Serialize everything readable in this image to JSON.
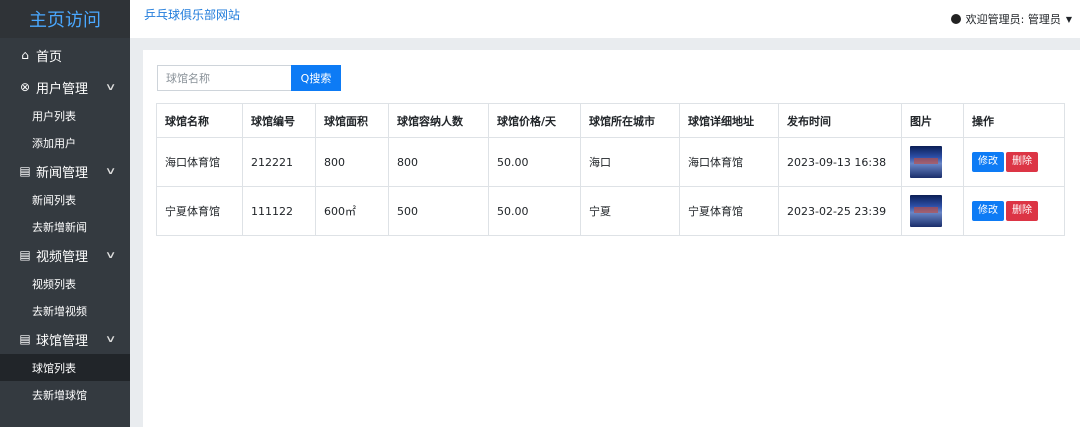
{
  "sidebar": {
    "brand": "主页访问",
    "home": {
      "icon": "home-icon",
      "label": "首页"
    },
    "groups": [
      {
        "icon": "user-circle-icon",
        "label": "用户管理",
        "items": [
          "用户列表",
          "添加用户"
        ]
      },
      {
        "icon": "document-icon",
        "label": "新闻管理",
        "items": [
          "新闻列表",
          "去新增新闻"
        ]
      },
      {
        "icon": "document-icon",
        "label": "视频管理",
        "items": [
          "视频列表",
          "去新增视频"
        ]
      },
      {
        "icon": "document-icon",
        "label": "球馆管理",
        "items": [
          "球馆列表",
          "去新增球馆"
        ]
      }
    ],
    "active_item": "球馆列表"
  },
  "header": {
    "site_title": "乒乓球俱乐部网站",
    "user_label": "欢迎管理员: 管理员"
  },
  "search": {
    "placeholder": "球馆名称",
    "value": "",
    "button_label": "Q搜索"
  },
  "table": {
    "columns": [
      "球馆名称",
      "球馆编号",
      "球馆面积",
      "球馆容纳人数",
      "球馆价格/天",
      "球馆所在城市",
      "球馆详细地址",
      "发布时间",
      "图片",
      "操作"
    ],
    "rows": [
      {
        "name": "海口体育馆",
        "code": "212221",
        "area": "800",
        "capacity": "800",
        "price": "50.00",
        "city": "海口",
        "address": "海口体育馆",
        "time": "2023-09-13 16:38"
      },
      {
        "name": "宁夏体育馆",
        "code": "111122",
        "area": "600㎡",
        "capacity": "500",
        "price": "50.00",
        "city": "宁夏",
        "address": "宁夏体育馆",
        "time": "2023-02-25 23:39"
      }
    ],
    "edit_label": "修改",
    "delete_label": "删除"
  },
  "colors": {
    "sidebar_bg": "#343a40",
    "primary": "#0d7bf5",
    "danger": "#dc3545",
    "brand_text": "#4aa8ff"
  }
}
